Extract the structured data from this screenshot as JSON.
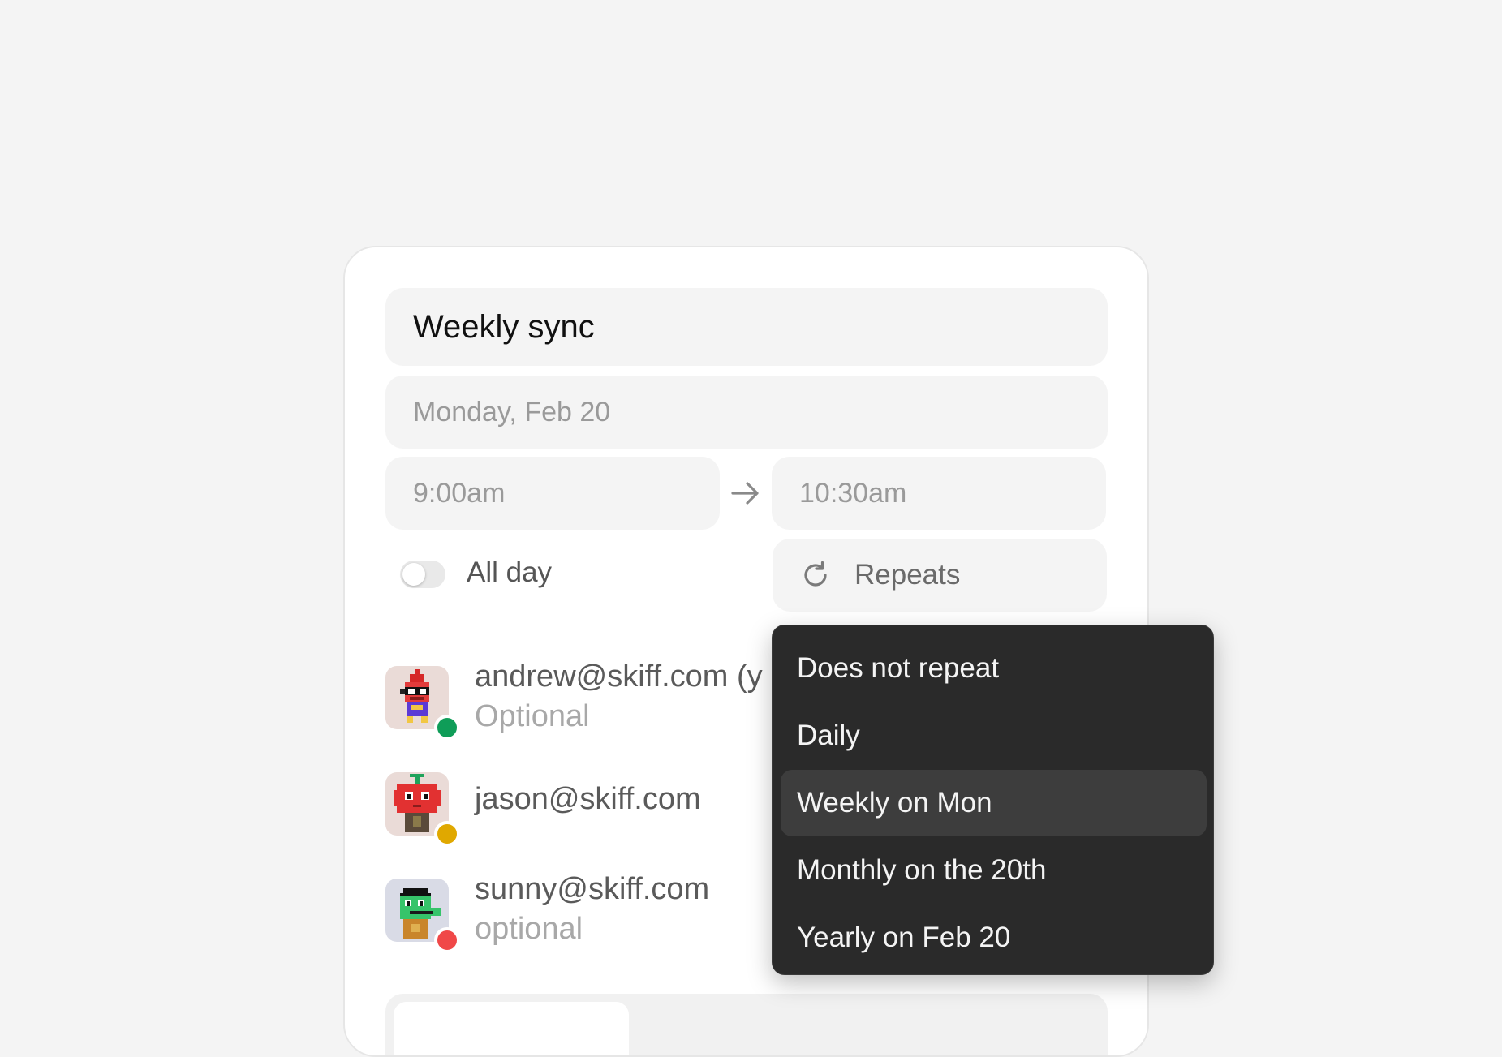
{
  "event": {
    "title": "Weekly sync",
    "date": "Monday, Feb 20",
    "start_time": "9:00am",
    "end_time": "10:30am",
    "all_day_label": "All day",
    "all_day_enabled": false,
    "repeats_label": "Repeats"
  },
  "attendees": [
    {
      "email": "andrew@skiff.com (y",
      "sub": "Optional",
      "status_color": "#0f9d58",
      "avatar": "red-hat-robot"
    },
    {
      "email": "jason@skiff.com",
      "sub": "",
      "status_color": "#e0a800",
      "avatar": "tomato-character"
    },
    {
      "email": "sunny@skiff.com",
      "sub": "optional",
      "status_color": "#f04848",
      "avatar": "green-pixel-character"
    }
  ],
  "repeat_menu": {
    "items": [
      {
        "label": "Does not repeat"
      },
      {
        "label": "Daily"
      },
      {
        "label": "Weekly on Mon"
      },
      {
        "label": "Monthly on the 20th"
      },
      {
        "label": "Yearly on Feb 20"
      }
    ],
    "selected_index": 2
  },
  "icons": {
    "arrow": "arrow-right-icon",
    "repeat": "repeat-icon"
  }
}
